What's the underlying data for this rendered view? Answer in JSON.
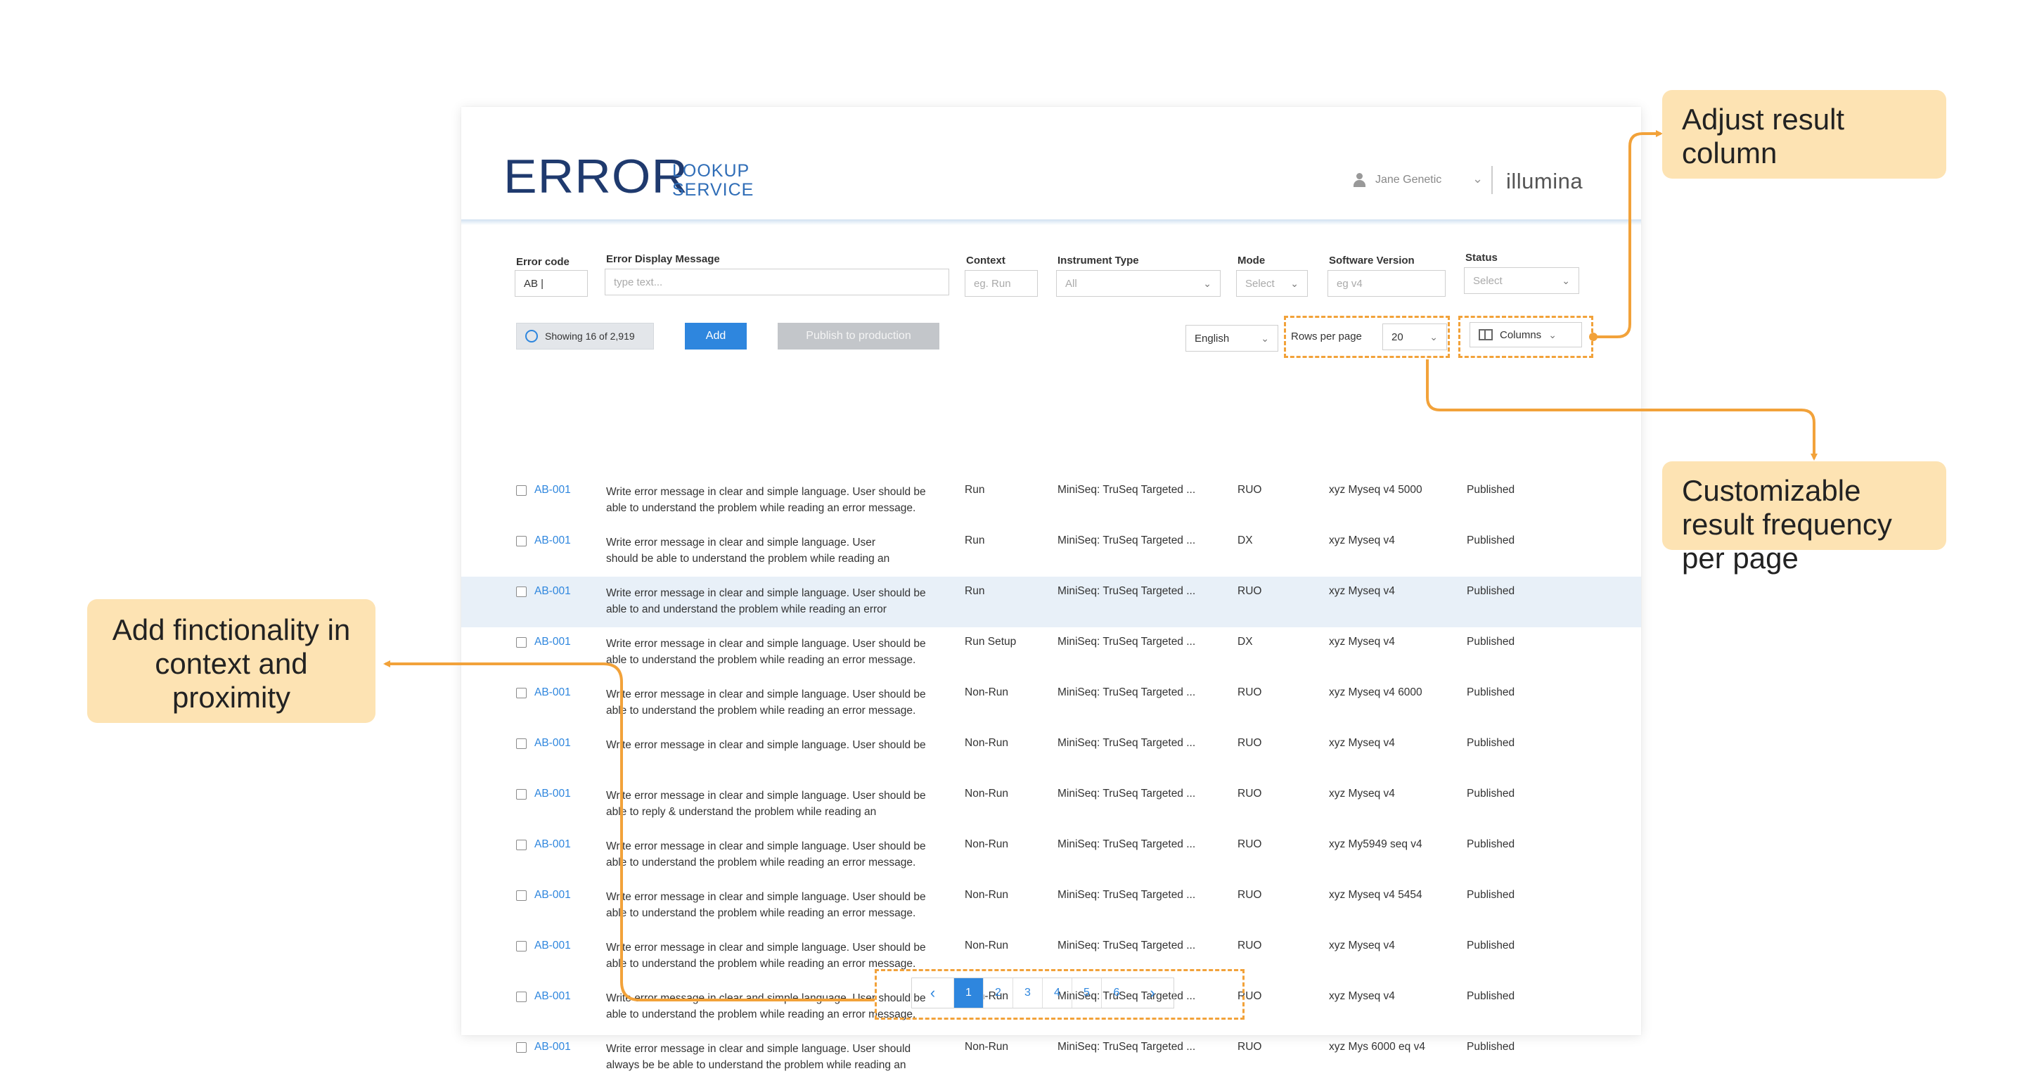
{
  "app": {
    "logo_main": "ERROR",
    "logo_sub_line1": "LOOKUP",
    "logo_sub_line2": "SERVICE",
    "user_name": "Jane Genetic",
    "brand": "illumina"
  },
  "filters": {
    "error_code": {
      "label": "Error code",
      "value": "AB |"
    },
    "message": {
      "label": "Error Display Message",
      "placeholder": "type text..."
    },
    "context": {
      "label": "Context",
      "placeholder": "eg. Run"
    },
    "instrument": {
      "label": "Instrument Type",
      "value": "All"
    },
    "mode": {
      "label": "Mode",
      "value": "Select"
    },
    "software": {
      "label": "Software Version",
      "placeholder": "eg v4"
    },
    "status": {
      "label": "Status",
      "value": "Select"
    }
  },
  "toolbar": {
    "showing": "Showing 16 of 2,919",
    "add": "Add",
    "publish": "Publish to production",
    "language": "English",
    "rows_per_page_label": "Rows per page",
    "rows_per_page": "20",
    "columns": "Columns"
  },
  "rows": [
    {
      "code": "AB-001",
      "msg1": "Write error message in clear and simple language. User should be",
      "msg2": "able to understand the problem while reading an error message.",
      "context": "Run",
      "instrument": "MiniSeq: TruSeq Targeted ...",
      "mode": "RUO",
      "software": "xyz Myseq v4 5000",
      "status": "Published"
    },
    {
      "code": "AB-001",
      "msg1": "Write error message in clear and simple language. User",
      "msg2": "should be able to understand the problem while reading an",
      "context": "Run",
      "instrument": "MiniSeq: TruSeq Targeted ...",
      "mode": "DX",
      "software": "xyz Myseq v4",
      "status": "Published"
    },
    {
      "code": "AB-001",
      "msg1": "Write error message in clear and simple language. User should be",
      "msg2": "able to  and understand the problem while reading an error",
      "context": "Run",
      "instrument": "MiniSeq: TruSeq Targeted ...",
      "mode": "RUO",
      "software": "xyz Myseq v4",
      "status": "Published"
    },
    {
      "code": "AB-001",
      "msg1": "Write error message in clear and simple language. User should be",
      "msg2": "able to understand the problem while reading an error message.",
      "context": "Run Setup",
      "instrument": "MiniSeq: TruSeq Targeted ...",
      "mode": "DX",
      "software": "xyz Myseq v4",
      "status": "Published"
    },
    {
      "code": "AB-001",
      "msg1": "Write error message in clear and simple language. User should be",
      "msg2": "able to understand the problem while reading an error message.",
      "context": "Non-Run",
      "instrument": "MiniSeq: TruSeq Targeted ...",
      "mode": "RUO",
      "software": "xyz Myseq v4 6000",
      "status": "Published"
    },
    {
      "code": "AB-001",
      "msg1": "Write error message in clear and simple language. User should be",
      "msg2": "",
      "context": "Non-Run",
      "instrument": "MiniSeq: TruSeq Targeted ...",
      "mode": "RUO",
      "software": "xyz Myseq v4",
      "status": "Published"
    },
    {
      "code": "AB-001",
      "msg1": "Write error message in clear and simple language. User should be",
      "msg2": "able to reply & understand the problem while reading an",
      "context": "Non-Run",
      "instrument": "MiniSeq: TruSeq Targeted ...",
      "mode": "RUO",
      "software": "xyz Myseq v4",
      "status": "Published"
    },
    {
      "code": "AB-001",
      "msg1": "Write error message in clear and simple language. User should be",
      "msg2": "able to understand the problem while reading an error message.",
      "context": "Non-Run",
      "instrument": "MiniSeq: TruSeq Targeted ...",
      "mode": "RUO",
      "software": "xyz My5949 seq v4",
      "status": "Published"
    },
    {
      "code": "AB-001",
      "msg1": "Write error message in clear and simple language. User should be",
      "msg2": "able to understand the problem while reading an error message.",
      "context": "Non-Run",
      "instrument": "MiniSeq: TruSeq Targeted ...",
      "mode": "RUO",
      "software": "xyz Myseq v4 5454",
      "status": "Published"
    },
    {
      "code": "AB-001",
      "msg1": "Write error message in clear and simple language. User should be",
      "msg2": "able to understand the problem while reading an error message.",
      "context": "Non-Run",
      "instrument": "MiniSeq: TruSeq Targeted ...",
      "mode": "RUO",
      "software": "xyz Myseq v4",
      "status": "Published"
    },
    {
      "code": "AB-001",
      "msg1": "Write error message in clear and simple language. User should be",
      "msg2": "able to understand the problem while reading an error message.",
      "context": "Non-Run",
      "instrument": "MiniSeq: TruSeq Targeted ...",
      "mode": "RUO",
      "software": "xyz Myseq v4",
      "status": "Published"
    },
    {
      "code": "AB-001",
      "msg1": "Write error message in clear and simple language. User should",
      "msg2": "always be be able to understand the problem while reading an",
      "context": "Non-Run",
      "instrument": "MiniSeq: TruSeq Targeted ...",
      "mode": "RUO",
      "software": "xyz Mys 6000 eq v4",
      "status": "Published"
    }
  ],
  "highlighted_row": 2,
  "pagination": {
    "pages": [
      "1",
      "2",
      "3",
      "4",
      "5",
      "6"
    ],
    "active": "1"
  },
  "callouts": {
    "columns": "Adjust result column",
    "rows": "Customizable result frequency per page",
    "pager": "Add finctionality in context and proximity"
  },
  "colors": {
    "accent": "#2e86de",
    "annotation": "#f2a23a",
    "callout_bg": "#fde3b3",
    "logo": "#1f3a6e"
  },
  "icons": [
    "user-icon",
    "chevron-down-icon",
    "checkbox-icon",
    "columns-icon",
    "chevron-left-icon",
    "chevron-right-icon",
    "loading-ring-icon"
  ]
}
